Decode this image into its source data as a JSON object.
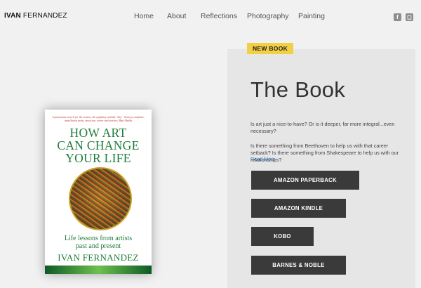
{
  "header": {
    "logo_bold": "IVAN",
    "logo_rest": " FERNANDEZ",
    "nav": [
      "Home",
      "About",
      "Reflections",
      "Photography",
      "Painting"
    ],
    "social": [
      {
        "icon": "facebook-icon",
        "glyph": "f"
      },
      {
        "icon": "instagram-icon",
        "glyph": "◻"
      }
    ]
  },
  "book_cover": {
    "quote": "A passionate search for the reason, the epiphany and the 'why' - history, sculpture, installation artist, musician, writer and teacher, Matt Shelby",
    "title_line1": "HOW ART",
    "title_line2": "CAN CHANGE",
    "title_line3": "YOUR LIFE",
    "subtitle_line1": "Life lessons from artists",
    "subtitle_line2": "past and present",
    "author": "IVAN FERNANDEZ"
  },
  "section": {
    "badge": "NEW BOOK",
    "heading": "The Book",
    "para1": "Is art just a nice-to-have? Or is it deeper, far more integral...even necessary?",
    "para2": "Is there something from Beethoven to help us with that career setback? Is there something from Shakespeare to help us with our relationships?",
    "read_more": "Read More",
    "buttons": [
      "AMAZON PAPERBACK",
      "AMAZON KINDLE",
      "KOBO",
      "BARNES & NOBLE"
    ]
  },
  "colors": {
    "accent_badge": "#f3cf44",
    "button_bg": "#3a3a3a",
    "link": "#2f6fb3",
    "cover_green": "#1e7d3a"
  }
}
